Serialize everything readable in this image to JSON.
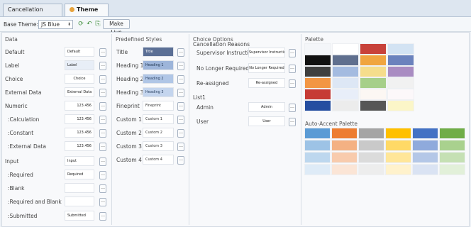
{
  "tabs": [
    {
      "label": "Cancellation Reasons",
      "active": false
    },
    {
      "label": "Theme",
      "active": true
    }
  ],
  "toolbar": {
    "base_theme_label": "Base Theme:",
    "base_theme_value": "JS Blue",
    "make_live_label": "Make Live"
  },
  "data_panel": {
    "title": "Data",
    "rows": [
      {
        "label": "Default",
        "swatch": "Default",
        "bg": "#ffffff"
      },
      {
        "label": "Label",
        "swatch": "Label",
        "bg": "#e8eef7"
      },
      {
        "label": "Choice",
        "swatch": "Choice",
        "bg": "#ffffff"
      },
      {
        "label": "External Data",
        "swatch": "External Data",
        "bg": "#ffffff"
      },
      {
        "label": "Numeric",
        "swatch": "123.456",
        "bg": "#ffffff"
      },
      {
        "label": ":Calculation",
        "swatch": "123.456",
        "bg": "#ffffff"
      },
      {
        "label": ":Constant",
        "swatch": "123.456",
        "bg": "#ffffff"
      },
      {
        "label": ":External Data",
        "swatch": "123.456",
        "bg": "#ffffff"
      },
      {
        "label": "Input",
        "swatch": "Input",
        "bg": "#ffffff"
      },
      {
        "label": ":Required",
        "swatch": "Required",
        "bg": "#ffffff"
      },
      {
        "label": ":Blank",
        "swatch": "",
        "bg": "#ffffff"
      },
      {
        "label": ":Required and Blank",
        "swatch": "",
        "bg": "#ffffff"
      },
      {
        "label": ":Submitted",
        "swatch": "Submitted",
        "bg": "#ffffff"
      }
    ]
  },
  "styles_panel": {
    "title": "Predefined Styles",
    "rows": [
      {
        "label": "Title",
        "swatch": "Title",
        "bg": "#5b6f95",
        "fg": "#ffffff"
      },
      {
        "label": "Heading 1",
        "swatch": "Heading 1",
        "bg": "#9db5da",
        "fg": "#1f3550"
      },
      {
        "label": "Heading 2",
        "swatch": "Heading 2",
        "bg": "#b0c6e6",
        "fg": "#2b4263"
      },
      {
        "label": "Heading 3",
        "swatch": "Heading 3",
        "bg": "#c4d5ee",
        "fg": "#2b4263"
      },
      {
        "label": "Fineprint",
        "swatch": "Fineprint",
        "bg": "#ffffff",
        "fg": "#333333"
      },
      {
        "label": "Custom 1",
        "swatch": "Custom 1",
        "bg": "#ffffff",
        "fg": "#333333"
      },
      {
        "label": "Custom 2",
        "swatch": "Custom 2",
        "bg": "#ffffff",
        "fg": "#333333"
      },
      {
        "label": "Custom 3",
        "swatch": "Custom 3",
        "bg": "#ffffff",
        "fg": "#333333"
      },
      {
        "label": "Custom 4",
        "swatch": "Custom 4",
        "bg": "#ffffff",
        "fg": "#333333"
      }
    ]
  },
  "choice_panel": {
    "title": "Choice Options",
    "groups": [
      {
        "heading": "Cancellation Reasons",
        "rows": [
          {
            "label": "Supervisor Instruction",
            "swatch": "Supervisor Instruction"
          },
          {
            "label": "No Longer Required",
            "swatch": "No Longer Required"
          },
          {
            "label": "Re-assigned",
            "swatch": "Re-assigned"
          }
        ]
      },
      {
        "heading": "List1",
        "rows": [
          {
            "label": "Admin",
            "swatch": "Admin"
          },
          {
            "label": "User",
            "swatch": "User"
          }
        ]
      }
    ]
  },
  "palette": {
    "title": "Palette",
    "colors": [
      [
        "#f4f6f9",
        "#ffffff",
        "#c8423a",
        "#d3e3f3"
      ],
      [
        "#111111",
        "#5f6f8e",
        "#f0a540",
        "#6b82bd"
      ],
      [
        "#3f3f3f",
        "#a4bbe0",
        "#f5dd8c",
        "#a98cc2"
      ],
      [
        "#f29644",
        "#dde7f5",
        "#a6cf8a",
        "#f1f1f1"
      ],
      [
        "#c63b35",
        "#e8eef9",
        "#fcf7f3",
        "#fcf8fa"
      ],
      [
        "#244ea0",
        "#ececec",
        "#565656",
        "#fbf6c8"
      ]
    ]
  },
  "accent_palette": {
    "title": "Auto-Accent Palette",
    "colors": [
      [
        "#5b9bd5",
        "#ed7d31",
        "#a5a5a5",
        "#ffc000",
        "#4472c4",
        "#70ad47"
      ],
      [
        "#9dc3e6",
        "#f4b183",
        "#c9c9c9",
        "#ffd966",
        "#8faadc",
        "#a9d18e"
      ],
      [
        "#bdd7ee",
        "#f8cbad",
        "#dbdbdb",
        "#ffe699",
        "#b4c7e7",
        "#c5e0b4"
      ],
      [
        "#deebf7",
        "#fbe5d6",
        "#ededed",
        "#fff2cc",
        "#dae3f3",
        "#e2f0d9"
      ]
    ]
  }
}
